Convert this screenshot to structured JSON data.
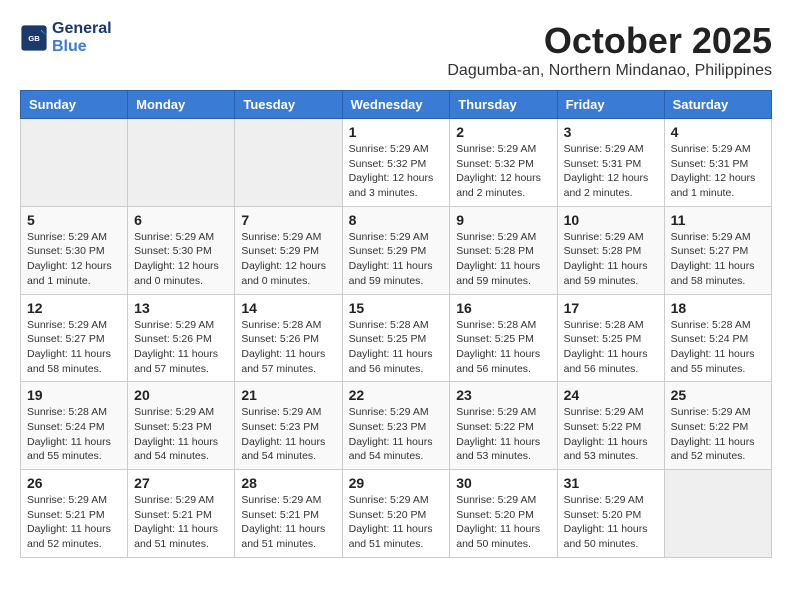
{
  "header": {
    "logo_line1": "General",
    "logo_line2": "Blue",
    "month": "October 2025",
    "location": "Dagumba-an, Northern Mindanao, Philippines"
  },
  "weekdays": [
    "Sunday",
    "Monday",
    "Tuesday",
    "Wednesday",
    "Thursday",
    "Friday",
    "Saturday"
  ],
  "weeks": [
    [
      {
        "day": "",
        "info": ""
      },
      {
        "day": "",
        "info": ""
      },
      {
        "day": "",
        "info": ""
      },
      {
        "day": "1",
        "info": "Sunrise: 5:29 AM\nSunset: 5:32 PM\nDaylight: 12 hours and 3 minutes."
      },
      {
        "day": "2",
        "info": "Sunrise: 5:29 AM\nSunset: 5:32 PM\nDaylight: 12 hours and 2 minutes."
      },
      {
        "day": "3",
        "info": "Sunrise: 5:29 AM\nSunset: 5:31 PM\nDaylight: 12 hours and 2 minutes."
      },
      {
        "day": "4",
        "info": "Sunrise: 5:29 AM\nSunset: 5:31 PM\nDaylight: 12 hours and 1 minute."
      }
    ],
    [
      {
        "day": "5",
        "info": "Sunrise: 5:29 AM\nSunset: 5:30 PM\nDaylight: 12 hours and 1 minute."
      },
      {
        "day": "6",
        "info": "Sunrise: 5:29 AM\nSunset: 5:30 PM\nDaylight: 12 hours and 0 minutes."
      },
      {
        "day": "7",
        "info": "Sunrise: 5:29 AM\nSunset: 5:29 PM\nDaylight: 12 hours and 0 minutes."
      },
      {
        "day": "8",
        "info": "Sunrise: 5:29 AM\nSunset: 5:29 PM\nDaylight: 11 hours and 59 minutes."
      },
      {
        "day": "9",
        "info": "Sunrise: 5:29 AM\nSunset: 5:28 PM\nDaylight: 11 hours and 59 minutes."
      },
      {
        "day": "10",
        "info": "Sunrise: 5:29 AM\nSunset: 5:28 PM\nDaylight: 11 hours and 59 minutes."
      },
      {
        "day": "11",
        "info": "Sunrise: 5:29 AM\nSunset: 5:27 PM\nDaylight: 11 hours and 58 minutes."
      }
    ],
    [
      {
        "day": "12",
        "info": "Sunrise: 5:29 AM\nSunset: 5:27 PM\nDaylight: 11 hours and 58 minutes."
      },
      {
        "day": "13",
        "info": "Sunrise: 5:29 AM\nSunset: 5:26 PM\nDaylight: 11 hours and 57 minutes."
      },
      {
        "day": "14",
        "info": "Sunrise: 5:28 AM\nSunset: 5:26 PM\nDaylight: 11 hours and 57 minutes."
      },
      {
        "day": "15",
        "info": "Sunrise: 5:28 AM\nSunset: 5:25 PM\nDaylight: 11 hours and 56 minutes."
      },
      {
        "day": "16",
        "info": "Sunrise: 5:28 AM\nSunset: 5:25 PM\nDaylight: 11 hours and 56 minutes."
      },
      {
        "day": "17",
        "info": "Sunrise: 5:28 AM\nSunset: 5:25 PM\nDaylight: 11 hours and 56 minutes."
      },
      {
        "day": "18",
        "info": "Sunrise: 5:28 AM\nSunset: 5:24 PM\nDaylight: 11 hours and 55 minutes."
      }
    ],
    [
      {
        "day": "19",
        "info": "Sunrise: 5:28 AM\nSunset: 5:24 PM\nDaylight: 11 hours and 55 minutes."
      },
      {
        "day": "20",
        "info": "Sunrise: 5:29 AM\nSunset: 5:23 PM\nDaylight: 11 hours and 54 minutes."
      },
      {
        "day": "21",
        "info": "Sunrise: 5:29 AM\nSunset: 5:23 PM\nDaylight: 11 hours and 54 minutes."
      },
      {
        "day": "22",
        "info": "Sunrise: 5:29 AM\nSunset: 5:23 PM\nDaylight: 11 hours and 54 minutes."
      },
      {
        "day": "23",
        "info": "Sunrise: 5:29 AM\nSunset: 5:22 PM\nDaylight: 11 hours and 53 minutes."
      },
      {
        "day": "24",
        "info": "Sunrise: 5:29 AM\nSunset: 5:22 PM\nDaylight: 11 hours and 53 minutes."
      },
      {
        "day": "25",
        "info": "Sunrise: 5:29 AM\nSunset: 5:22 PM\nDaylight: 11 hours and 52 minutes."
      }
    ],
    [
      {
        "day": "26",
        "info": "Sunrise: 5:29 AM\nSunset: 5:21 PM\nDaylight: 11 hours and 52 minutes."
      },
      {
        "day": "27",
        "info": "Sunrise: 5:29 AM\nSunset: 5:21 PM\nDaylight: 11 hours and 51 minutes."
      },
      {
        "day": "28",
        "info": "Sunrise: 5:29 AM\nSunset: 5:21 PM\nDaylight: 11 hours and 51 minutes."
      },
      {
        "day": "29",
        "info": "Sunrise: 5:29 AM\nSunset: 5:20 PM\nDaylight: 11 hours and 51 minutes."
      },
      {
        "day": "30",
        "info": "Sunrise: 5:29 AM\nSunset: 5:20 PM\nDaylight: 11 hours and 50 minutes."
      },
      {
        "day": "31",
        "info": "Sunrise: 5:29 AM\nSunset: 5:20 PM\nDaylight: 11 hours and 50 minutes."
      },
      {
        "day": "",
        "info": ""
      }
    ]
  ]
}
